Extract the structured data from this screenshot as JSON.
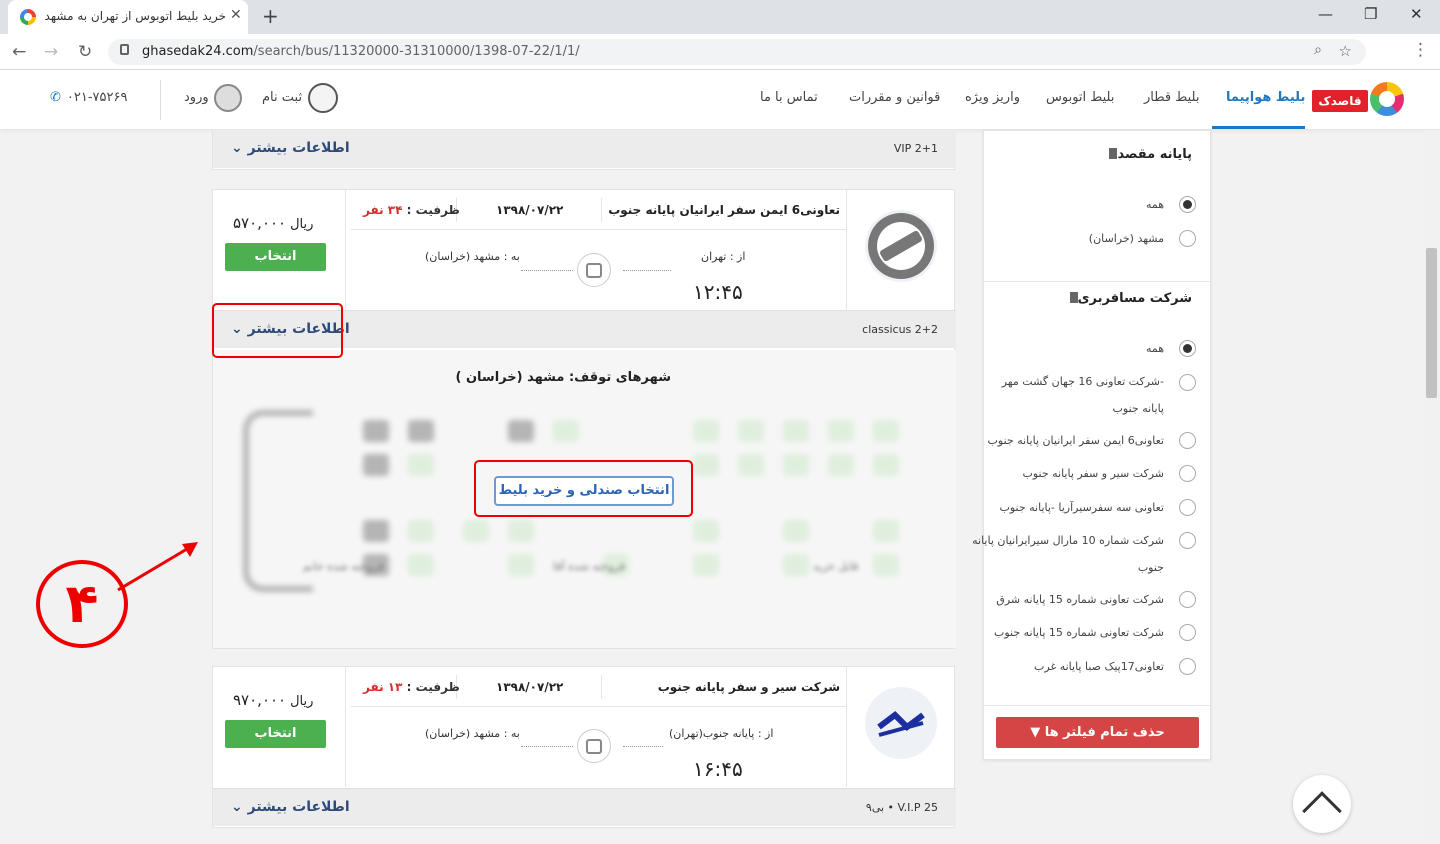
{
  "browser": {
    "tab_title": "خرید بلیط اتوبوس از تهران به مشهد",
    "tab_close": "✕",
    "new_tab": "+",
    "win_min": "—",
    "win_max": "❐",
    "win_close": "✕",
    "back": "←",
    "forward": "→",
    "reload": "↻",
    "url_domain": "ghasedak24.com",
    "url_path": "/search/bus/11320000-31310000/1398-07-22/1/1/",
    "zoom_icon": "⌕",
    "star_icon": "☆",
    "menu_icon": "⋮"
  },
  "header": {
    "logo_text": "قاصدک",
    "menu": [
      "بلیط هواپیما",
      "بلیط قطار",
      "بلیط اتوبوس",
      "واریز ویژه",
      "قوانین و مقررات",
      "تماس با ما"
    ],
    "phone": "۰۲۱-۷۵۲۶۹",
    "login": "ورود",
    "signup": "ثبت نام"
  },
  "top_card": {
    "more": "اطلاعات بیشتر",
    "bus_type": "VIP 2+1"
  },
  "card1": {
    "company": "تعاونی6 ایمن سفر ایرانیان پایانه جنوب",
    "date": "۱۳۹۸/۰۷/۲۲",
    "capacity_label": "ظرفیت :",
    "capacity_value": "۳۴ نفر",
    "from": "از : تهران",
    "to": "به : مشهد (خراسان)",
    "time": "۱۲:۴۵",
    "price": "۵۷۰,۰۰۰",
    "currency": "ریال",
    "select": "انتخاب",
    "more": "اطلاعات بیشتر",
    "bus_type": "classicus 2+2",
    "stops": "شهرهای توقف: مشهد (خراسان )",
    "choose_seat": "انتخاب صندلی و خرید بلیط",
    "legend": [
      "قابل خرید",
      "فروخته شده آقا",
      "فروخته شده خانم"
    ]
  },
  "card2": {
    "company": "شرکت سیر و سفر پایانه جنوب",
    "date": "۱۳۹۸/۰۷/۲۲",
    "capacity_label": "ظرفیت :",
    "capacity_value": "۱۳ نفر",
    "from": "از : پایانه جنوب(تهران)",
    "to": "به : مشهد (خراسان)",
    "time": "۱۶:۴۵",
    "price": "۹۷۰,۰۰۰",
    "currency": "ریال",
    "select": "انتخاب",
    "more": "اطلاعات بیشتر",
    "bus_type": "بی۹ • V.I.P 25"
  },
  "sidebar": {
    "dest_title": "پایانه مقصد",
    "dest_options": [
      "همه",
      "مشهد (خراسان)"
    ],
    "company_title": "شرکت مسافربری",
    "company_options": [
      "همه",
      "شرکت تعاونی 16 جهان گشت مهر-",
      "پایانه جنوب",
      "تعاونی6 ایمن سفر ایرانیان پایانه جنوب",
      "شرکت سیر و سفر پایانه جنوب",
      "تعاونی سه سفرسیرآریا -پایانه جنوب",
      "شرکت شماره 10 مارال سیرایرانیان پایانه",
      "جنوب",
      "شرکت تعاونی شماره 15 پایانه شرق",
      "شرکت تعاونی شماره 15 پایانه جنوب",
      "تعاونی17پیک صبا پایانه غرب"
    ],
    "clear": "حذف تمام فیلتر ها"
  },
  "annotation": {
    "step": "۴"
  },
  "colors": {
    "accent": "#1f78c1",
    "select_green": "#4caf50",
    "clear_red": "#d64545",
    "annotation_red": "#ee0000"
  }
}
